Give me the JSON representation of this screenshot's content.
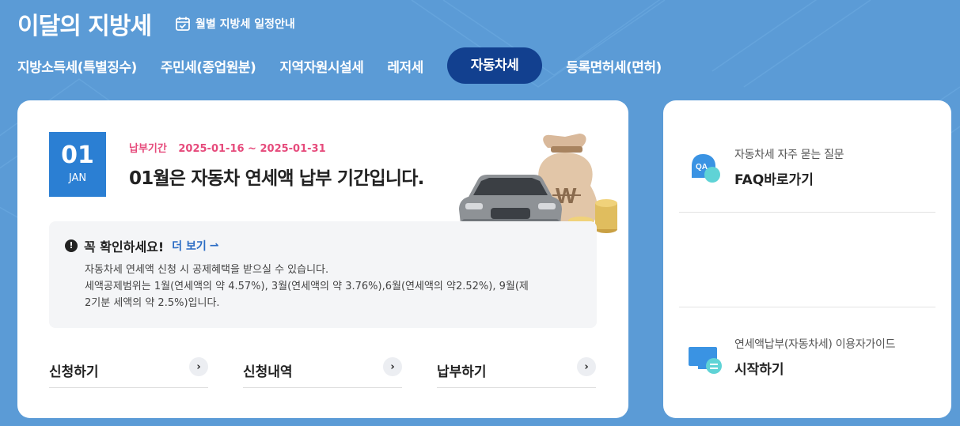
{
  "header": {
    "title": "이달의 지방세",
    "schedule_label": "월별 지방세 일정안내"
  },
  "tabs": [
    {
      "label": "지방소득세(특별징수)",
      "active": false
    },
    {
      "label": "주민세(종업원분)",
      "active": false
    },
    {
      "label": "지역자원시설세",
      "active": false
    },
    {
      "label": "레저세",
      "active": false
    },
    {
      "label": "자동차세",
      "active": true
    },
    {
      "label": "등록면허세(면허)",
      "active": false
    }
  ],
  "main": {
    "date_day": "01",
    "date_month": "JAN",
    "period_label": "납부기간",
    "period_dates": "2025-01-16 ~ 2025-01-31",
    "headline": "01월은 자동차 연세액 납부 기간입니다.",
    "notice": {
      "title": "꼭 확인하세요!",
      "more_label": "더 보기",
      "body_line1": "자동차세 연세액 신청 시 공제혜택을 받으실 수 있습니다.",
      "body_line2": "세액공제범위는 1월(연세액의 약 4.57%), 3월(연세액의 약 3.76%),6월(연세액의 약2.52%), 9월(제",
      "body_line3": "2기분 세액의 약 2.5%)입니다."
    },
    "actions": [
      {
        "label": "신청하기"
      },
      {
        "label": "신청내역"
      },
      {
        "label": "납부하기"
      }
    ]
  },
  "side": {
    "faq": {
      "subtitle": "자동차세 자주 묻는 질문",
      "link": "FAQ바로가기",
      "icon_text": "QA"
    },
    "guide": {
      "subtitle": "연세액납부(자동차세) 이용자가이드",
      "link": "시작하기"
    }
  },
  "colors": {
    "background": "#5b9bd6",
    "active_tab": "#12408f",
    "date_box": "#2b7fd3",
    "period": "#e64a7b",
    "link": "#2b6cc4"
  },
  "icons": {
    "calendar": "calendar-check-icon",
    "alert": "exclamation-icon",
    "chevron": "chevron-right-icon",
    "faq": "qa-chat-icon",
    "guide": "monitor-guide-icon"
  }
}
